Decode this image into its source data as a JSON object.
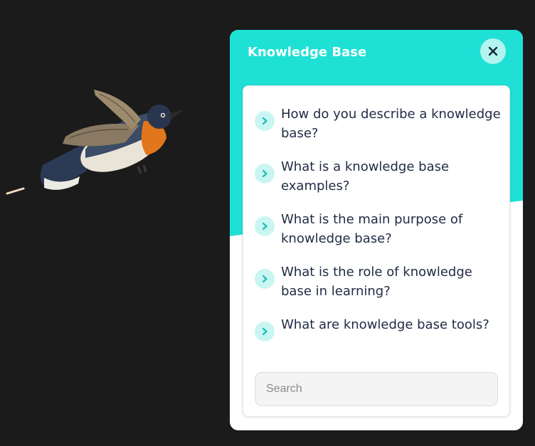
{
  "widget": {
    "title": "Knowledge Base",
    "close_icon": "close-icon",
    "accent_color": "#1ee0d5",
    "faq_items": [
      {
        "label": "How do you describe a knowledge base?"
      },
      {
        "label": "What is a knowledge base examples?"
      },
      {
        "label": "What is the main purpose of knowledge base?"
      },
      {
        "label": "What is the role of knowledge base in learning?"
      },
      {
        "label": "What are knowledge base tools?"
      }
    ],
    "item_icon": "chevron-right-icon",
    "search": {
      "placeholder": "Search",
      "value": ""
    }
  },
  "background": {
    "color": "#1b1b1b",
    "illustration": "flying-bird-illustration"
  }
}
